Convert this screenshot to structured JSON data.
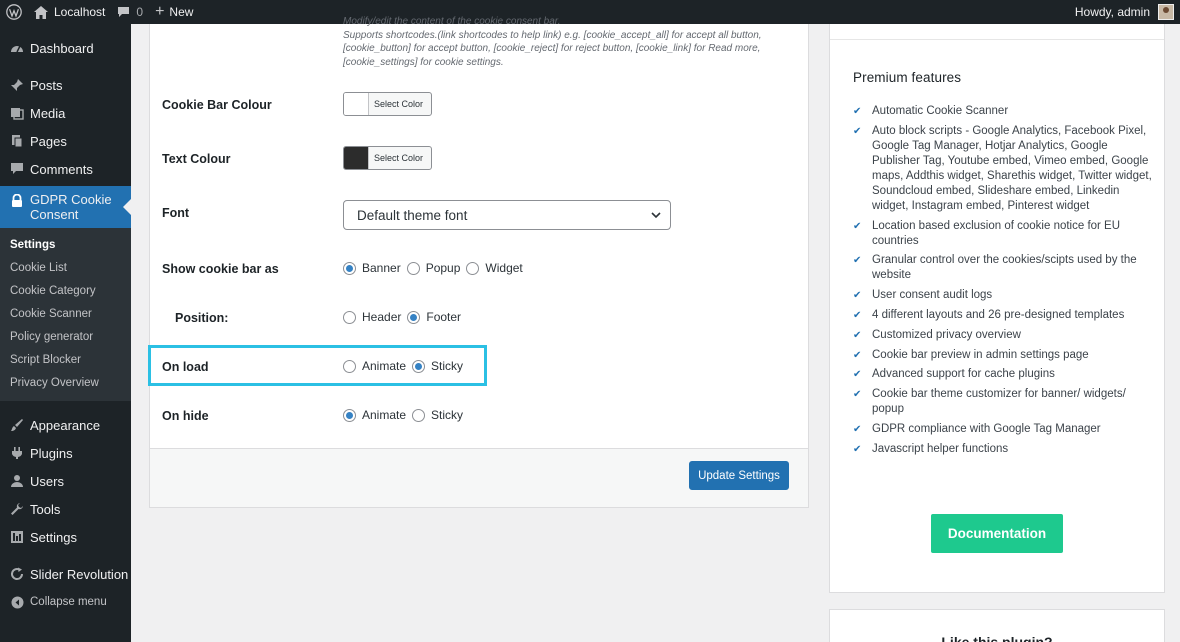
{
  "adminbar": {
    "site_name": "Localhost",
    "comments_count": "0",
    "new_label": "New",
    "howdy": "Howdy, admin"
  },
  "sidebar": {
    "items_top": [
      {
        "label": "Dashboard",
        "icon": "dashboard-icon"
      },
      {
        "label": "Posts",
        "icon": "pin-icon"
      },
      {
        "label": "Media",
        "icon": "media-icon"
      },
      {
        "label": "Pages",
        "icon": "pages-icon"
      },
      {
        "label": "Comments",
        "icon": "comment-icon"
      }
    ],
    "current": {
      "label": "GDPR Cookie Consent",
      "icon": "lock-icon"
    },
    "submenu": [
      "Settings",
      "Cookie List",
      "Cookie Category",
      "Cookie Scanner",
      "Policy generator",
      "Script Blocker",
      "Privacy Overview"
    ],
    "items_bottom": [
      {
        "label": "Appearance",
        "icon": "brush-icon"
      },
      {
        "label": "Plugins",
        "icon": "plug-icon"
      },
      {
        "label": "Users",
        "icon": "user-icon"
      },
      {
        "label": "Tools",
        "icon": "wrench-icon"
      },
      {
        "label": "Settings",
        "icon": "settings-icon"
      }
    ],
    "slider": {
      "label": "Slider Revolution",
      "icon": "refresh-icon"
    },
    "collapse": {
      "label": "Collapse menu",
      "icon": "collapse-icon"
    }
  },
  "form": {
    "help_line1": "Modify/edit the content of the cookie consent bar.",
    "help_line2": "Supports shortcodes.(link shortcodes to help link) e.g. [cookie_accept_all] for accept all button, [cookie_button] for accept button, [cookie_reject] for reject button, [cookie_link] for Read more, [cookie_settings] for cookie settings.",
    "cookie_bar_colour": {
      "label": "Cookie Bar Colour",
      "button": "Select Color",
      "color": "#ffffff"
    },
    "text_colour": {
      "label": "Text Colour",
      "button": "Select Color",
      "color": "#2c2c2c"
    },
    "font": {
      "label": "Font",
      "value": "Default theme font"
    },
    "show_as": {
      "label": "Show cookie bar as",
      "options": [
        "Banner",
        "Popup",
        "Widget"
      ],
      "selected": "Banner"
    },
    "position": {
      "label": "Position:",
      "options": [
        "Header",
        "Footer"
      ],
      "selected": "Footer"
    },
    "on_load": {
      "label": "On load",
      "options": [
        "Animate",
        "Sticky"
      ],
      "selected": "Sticky"
    },
    "on_hide": {
      "label": "On hide",
      "options": [
        "Animate",
        "Sticky"
      ],
      "selected": "Animate"
    },
    "update_button": "Update Settings"
  },
  "premium": {
    "title": "Premium features",
    "features": [
      "Automatic Cookie Scanner",
      "Auto block scripts - Google Analytics, Facebook Pixel, Google Tag Manager, Hotjar Analytics, Google Publisher Tag, Youtube embed, Vimeo embed, Google maps, Addthis widget, Sharethis widget, Twitter widget, Soundcloud embed, Slideshare embed, Linkedin widget, Instagram embed, Pinterest widget",
      "Location based exclusion of cookie notice for EU countries",
      "Granular control over the cookies/scipts used by the website",
      "User consent audit logs",
      "4 different layouts and 26 pre-designed templates",
      "Customized privacy overview",
      "Cookie bar preview in admin settings page",
      "Advanced support for cache plugins",
      "Cookie bar theme customizer for banner/ widgets/ popup",
      "GDPR compliance with Google Tag Manager",
      "Javascript helper functions"
    ],
    "doc_button": "Documentation"
  },
  "like": {
    "title": "Like this plugin?"
  },
  "colors": {
    "accent": "#2271b1",
    "highlight": "#2bc0e4",
    "doc_button": "#1ec98e",
    "admin_dark": "#1d2327"
  }
}
